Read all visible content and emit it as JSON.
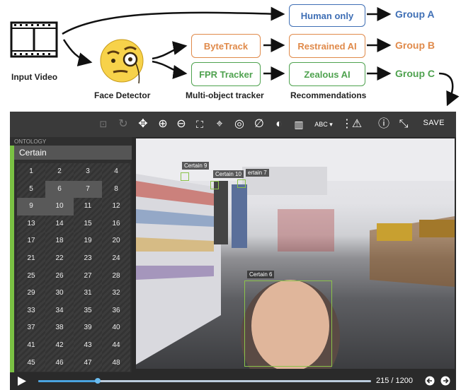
{
  "diagram": {
    "input_label": "Input Video",
    "face_detector_label": "Face Detector",
    "tracker_label": "Multi-object tracker",
    "recommendations_label": "Recommendations",
    "bytetrack": "ByteTrack",
    "fpr_tracker": "FPR Tracker",
    "human_only": "Human only",
    "restrained_ai": "Restrained AI",
    "zealous_ai": "Zealous AI",
    "group_a": "Group A",
    "group_b": "Group B",
    "group_c": "Group C",
    "colors": {
      "blue": "#3f6fb5",
      "orange": "#e08a4a",
      "green": "#4fa24f"
    }
  },
  "toolbar": {
    "icons": [
      "fit-icon",
      "rotate-icon",
      "move-icon",
      "zoom-in-icon",
      "zoom-out-icon",
      "fullscreen-icon",
      "crosshair-icon",
      "target-icon",
      "null-icon",
      "contrast-icon",
      "map-icon",
      "abc-label-icon",
      "list-icon",
      "warning-icon",
      "info-icon",
      "collapse-icon"
    ],
    "save_label": "SAVE"
  },
  "sidebar": {
    "ontology_label": "ONTOLOGY",
    "category": "Certain",
    "numbers": [
      "1",
      "2",
      "3",
      "4",
      "5",
      "6",
      "7",
      "8",
      "9",
      "10",
      "11",
      "12",
      "13",
      "14",
      "15",
      "16",
      "17",
      "18",
      "19",
      "20",
      "21",
      "22",
      "23",
      "24",
      "25",
      "26",
      "27",
      "28",
      "29",
      "30",
      "31",
      "32",
      "33",
      "34",
      "35",
      "36",
      "37",
      "38",
      "39",
      "40",
      "41",
      "42",
      "43",
      "44",
      "45",
      "46",
      "47",
      "48"
    ],
    "selected": [
      "6",
      "7",
      "9",
      "10"
    ]
  },
  "video": {
    "boxes": [
      {
        "label": "Certain 9"
      },
      {
        "label": "Certain 10"
      },
      {
        "label": "ertain 7"
      },
      {
        "label": "Certain 6"
      }
    ]
  },
  "player": {
    "current_frame": 215,
    "total_frames": 1200,
    "counter": "215 / 1200"
  }
}
